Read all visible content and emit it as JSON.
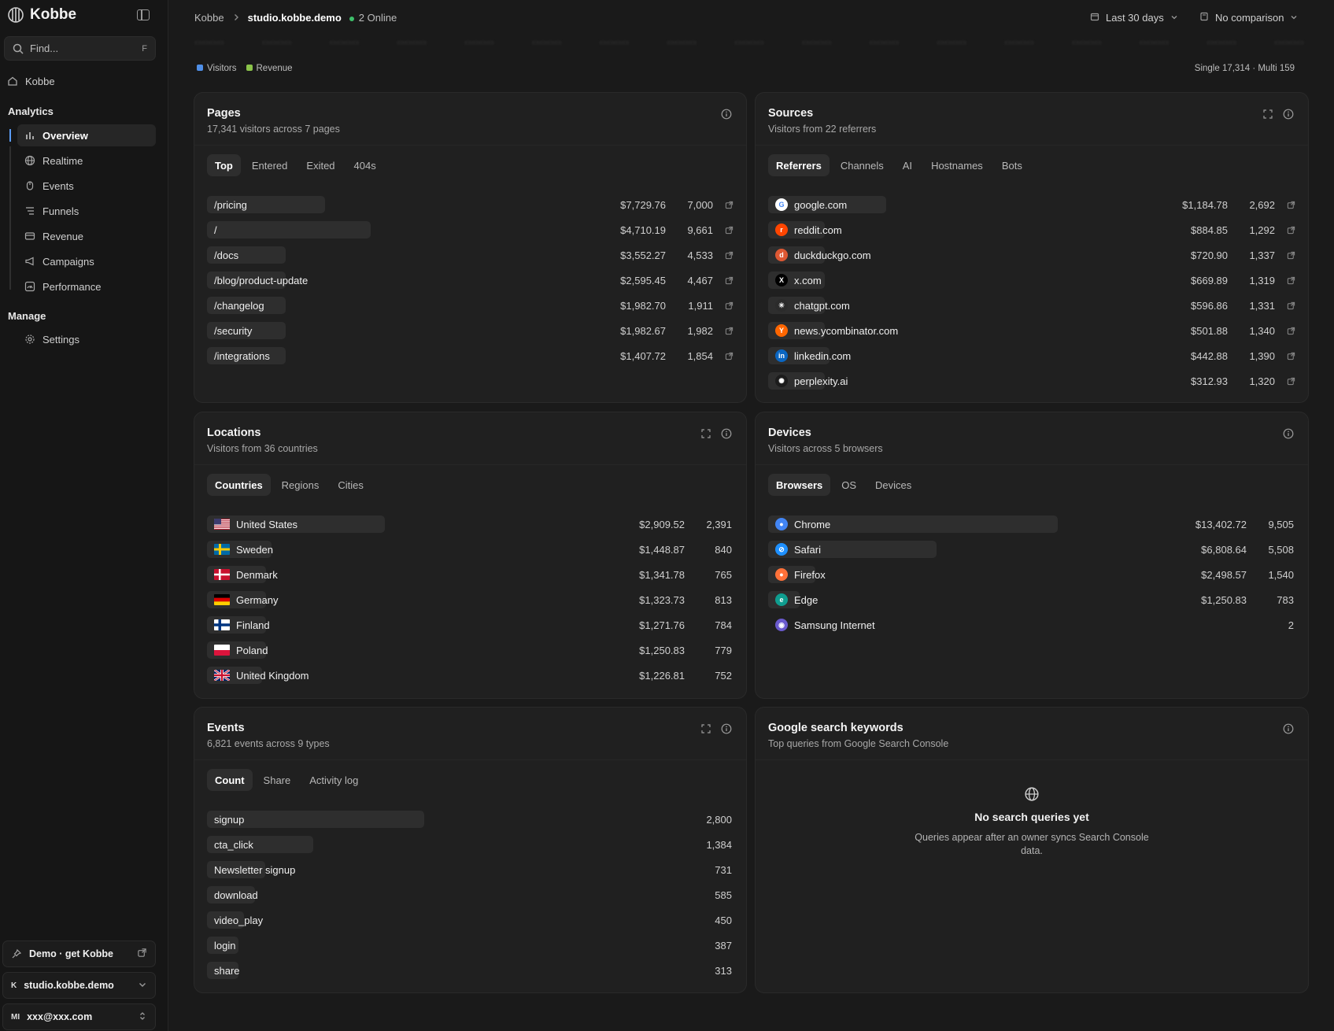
{
  "sidebar": {
    "brand": "Kobbe",
    "find_placeholder": "Find...",
    "find_kbd": "F",
    "home": "Kobbe",
    "analytics_heading": "Analytics",
    "analytics_items": [
      {
        "label": "Overview",
        "icon": "bar-chart-icon"
      },
      {
        "label": "Realtime",
        "icon": "globe-icon"
      },
      {
        "label": "Events",
        "icon": "pointer-icon"
      },
      {
        "label": "Funnels",
        "icon": "funnel-icon"
      },
      {
        "label": "Revenue",
        "icon": "card-icon"
      },
      {
        "label": "Campaigns",
        "icon": "megaphone-icon"
      },
      {
        "label": "Performance",
        "icon": "gauge-icon"
      }
    ],
    "manage_heading": "Manage",
    "settings": "Settings",
    "demo": "Demo · get Kobbe",
    "site_badge": "K",
    "site": "studio.kobbe.demo",
    "user_badge": "MI",
    "user": "xxx@xxx.com"
  },
  "topbar": {
    "crumb_root": "Kobbe",
    "crumb_site": "studio.kobbe.demo",
    "online": "2 Online",
    "range": "Last 30 days",
    "comparison": "No comparison"
  },
  "chart_strip": {
    "legend": [
      {
        "label": "Visitors",
        "color": "#4f8fe8"
      },
      {
        "label": "Revenue",
        "color": "#8bc34a"
      }
    ],
    "summary": "Single 17,314 · Multi 159"
  },
  "pages": {
    "title": "Pages",
    "subtitle": "17,341 visitors across 7 pages",
    "tabs": [
      "Top",
      "Entered",
      "Exited",
      "404s"
    ],
    "rows": [
      {
        "label": "/pricing",
        "money": "$7,729.76",
        "count": "7,000",
        "share": 0.23
      },
      {
        "label": "/",
        "money": "$4,710.19",
        "count": "9,661",
        "share": 0.32
      },
      {
        "label": "/docs",
        "money": "$3,552.27",
        "count": "4,533",
        "share": 0.15
      },
      {
        "label": "/blog/product-update",
        "money": "$2,595.45",
        "count": "4,467",
        "share": 0.15
      },
      {
        "label": "/changelog",
        "money": "$1,982.70",
        "count": "1,911",
        "share": 0.06
      },
      {
        "label": "/security",
        "money": "$1,982.67",
        "count": "1,982",
        "share": 0.07
      },
      {
        "label": "/integrations",
        "money": "$1,407.72",
        "count": "1,854",
        "share": 0.06
      }
    ]
  },
  "sources": {
    "title": "Sources",
    "subtitle": "Visitors from 22 referrers",
    "tabs": [
      "Referrers",
      "Channels",
      "AI",
      "Hostnames",
      "Bots"
    ],
    "rows": [
      {
        "label": "google.com",
        "money": "$1,184.78",
        "count": "2,692",
        "share": 0.23,
        "icon": "google-icon",
        "color": "#ffffff",
        "glyph": "G"
      },
      {
        "label": "reddit.com",
        "money": "$884.85",
        "count": "1,292",
        "share": 0.11,
        "icon": "reddit-icon",
        "color": "#ff4500",
        "glyph": "r"
      },
      {
        "label": "duckduckgo.com",
        "money": "$720.90",
        "count": "1,337",
        "share": 0.11,
        "icon": "duckduckgo-icon",
        "color": "#de5833",
        "glyph": "d"
      },
      {
        "label": "x.com",
        "money": "$669.89",
        "count": "1,319",
        "share": 0.11,
        "icon": "x-icon",
        "color": "#000000",
        "glyph": "X"
      },
      {
        "label": "chatgpt.com",
        "money": "$596.86",
        "count": "1,331",
        "share": 0.11,
        "icon": "chatgpt-icon",
        "color": "#2b2b2b",
        "glyph": "✳"
      },
      {
        "label": "news.ycombinator.com",
        "money": "$501.88",
        "count": "1,340",
        "share": 0.11,
        "icon": "ycombinator-icon",
        "color": "#ff6600",
        "glyph": "Y"
      },
      {
        "label": "linkedin.com",
        "money": "$442.88",
        "count": "1,390",
        "share": 0.12,
        "icon": "linkedin-icon",
        "color": "#0a66c2",
        "glyph": "in"
      },
      {
        "label": "perplexity.ai",
        "money": "$312.93",
        "count": "1,320",
        "share": 0.11,
        "icon": "perplexity-icon",
        "color": "#1c1c1c",
        "glyph": "✺"
      }
    ]
  },
  "locations": {
    "title": "Locations",
    "subtitle": "Visitors from 36 countries",
    "tabs": [
      "Countries",
      "Regions",
      "Cities"
    ],
    "rows": [
      {
        "label": "United States",
        "money": "$2,909.52",
        "count": "2,391",
        "share": 0.36,
        "flag": "us-flag-icon"
      },
      {
        "label": "Sweden",
        "money": "$1,448.87",
        "count": "840",
        "share": 0.13,
        "flag": "se-flag-icon"
      },
      {
        "label": "Denmark",
        "money": "$1,341.78",
        "count": "765",
        "share": 0.12,
        "flag": "dk-flag-icon"
      },
      {
        "label": "Germany",
        "money": "$1,323.73",
        "count": "813",
        "share": 0.12,
        "flag": "de-flag-icon"
      },
      {
        "label": "Finland",
        "money": "$1,271.76",
        "count": "784",
        "share": 0.12,
        "flag": "fi-flag-icon"
      },
      {
        "label": "Poland",
        "money": "$1,250.83",
        "count": "779",
        "share": 0.12,
        "flag": "pl-flag-icon"
      },
      {
        "label": "United Kingdom",
        "money": "$1,226.81",
        "count": "752",
        "share": 0.11,
        "flag": "gb-flag-icon"
      }
    ]
  },
  "devices": {
    "title": "Devices",
    "subtitle": "Visitors across 5 browsers",
    "tabs": [
      "Browsers",
      "OS",
      "Devices"
    ],
    "rows": [
      {
        "label": "Chrome",
        "money": "$13,402.72",
        "count": "9,505",
        "share": 0.55,
        "icon": "chrome-icon",
        "color": "#4285f4",
        "glyph": "●"
      },
      {
        "label": "Safari",
        "money": "$6,808.64",
        "count": "5,508",
        "share": 0.32,
        "icon": "safari-icon",
        "color": "#1e90ff",
        "glyph": "⊘"
      },
      {
        "label": "Firefox",
        "money": "$2,498.57",
        "count": "1,540",
        "share": 0.09,
        "icon": "firefox-icon",
        "color": "#ff7139",
        "glyph": "●"
      },
      {
        "label": "Edge",
        "money": "$1,250.83",
        "count": "783",
        "share": 0.05,
        "icon": "edge-icon",
        "color": "#0f9d8f",
        "glyph": "e"
      },
      {
        "label": "Samsung Internet",
        "money": "",
        "count": "2",
        "share": 0.0,
        "icon": "samsung-internet-icon",
        "color": "#6a5acd",
        "glyph": "◉"
      }
    ]
  },
  "events": {
    "title": "Events",
    "subtitle": "6,821 events across 9 types",
    "tabs": [
      "Count",
      "Share",
      "Activity log"
    ],
    "rows": [
      {
        "label": "signup",
        "count": "2,800",
        "share": 0.41
      },
      {
        "label": "cta_click",
        "count": "1,384",
        "share": 0.2
      },
      {
        "label": "Newsletter signup",
        "count": "731",
        "share": 0.11
      },
      {
        "label": "download",
        "count": "585",
        "share": 0.09
      },
      {
        "label": "video_play",
        "count": "450",
        "share": 0.07
      },
      {
        "label": "login",
        "count": "387",
        "share": 0.06
      },
      {
        "label": "share",
        "count": "313",
        "share": 0.05
      }
    ]
  },
  "keywords": {
    "title": "Google search keywords",
    "subtitle": "Top queries from Google Search Console",
    "empty_title": "No search queries yet",
    "empty_desc": "Queries appear after an owner syncs Search Console data."
  }
}
